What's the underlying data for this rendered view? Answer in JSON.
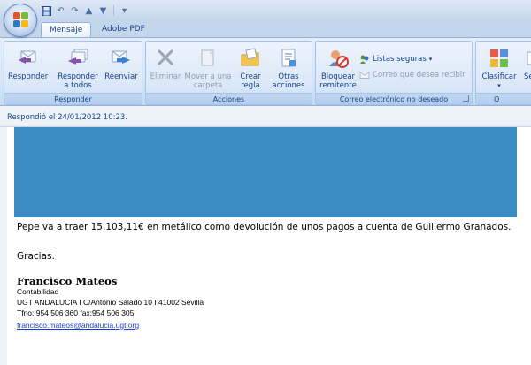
{
  "tabs": [
    {
      "label": "Mensaje",
      "active": true
    },
    {
      "label": "Adobe PDF",
      "active": false
    }
  ],
  "ribbon": {
    "responder_group": {
      "label": "Responder",
      "buttons": [
        {
          "label": "Responder",
          "icon": "reply-icon"
        },
        {
          "label": "Responder a todos",
          "line1": "Responder",
          "line2": "a todos",
          "icon": "reply-all-icon"
        },
        {
          "label": "Reenviar",
          "icon": "forward-icon"
        }
      ]
    },
    "acciones_group": {
      "label": "Acciones",
      "buttons": [
        {
          "label": "Eliminar",
          "icon": "delete-icon",
          "disabled": true
        },
        {
          "line1": "Mover a una",
          "line2": "carpeta",
          "icon": "move-to-folder-icon",
          "disabled": true
        },
        {
          "line1": "Crear",
          "line2": "regla",
          "icon": "create-rule-icon",
          "disabled": false
        },
        {
          "line1": "Otras",
          "line2": "acciones",
          "icon": "other-actions-icon",
          "disabled": false
        }
      ]
    },
    "junk_group": {
      "label": "Correo electrónico no deseado",
      "block": {
        "line1": "Bloquear",
        "line2": "remitente",
        "icon": "block-sender-icon"
      },
      "safe_lists": "Listas seguras",
      "not_junk": "Correo que desea recibir"
    },
    "classify_group": {
      "label": "Clasificar",
      "seg": "Seg"
    }
  },
  "info": {
    "replied": "Respondió el 24/01/2012 10:23."
  },
  "message": {
    "body": "Pepe va a traer 15.103,11€ en metálico como devolución de unos pagos a cuenta de Guillermo Granados.",
    "thanks": "Gracias.",
    "signature": {
      "name": "Francisco Mateos",
      "dept": "Contabilidad",
      "address": "UGT ANDALUCIA I  C/Antonio Salado 10  I 41002 Sevilla",
      "phone": "Tfno: 954 506 360 fax:954 506 305",
      "email": "francisco.mateos@andalucia.ugt.org"
    }
  },
  "colors": {
    "redaction": "#3b8cc2",
    "accent": "#15428b"
  }
}
